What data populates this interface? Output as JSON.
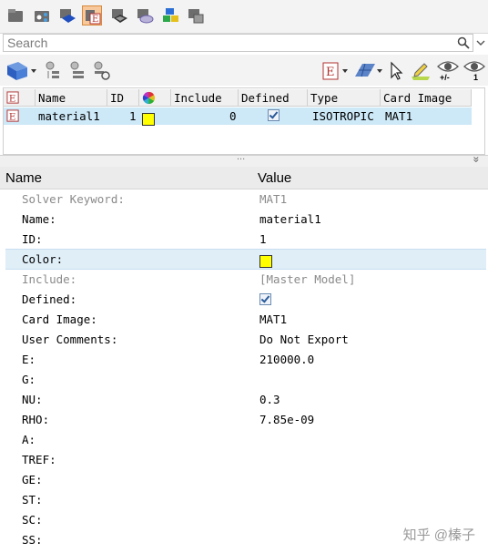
{
  "top_toolbar": {
    "icons": [
      "assembly-icon",
      "connector-icon",
      "component-icon",
      "material-icon",
      "property-icon",
      "system-icon",
      "multi-component-icon",
      "sets-icon"
    ],
    "active_index": 3
  },
  "search": {
    "placeholder": "Search"
  },
  "toolbar2": {
    "icons": [
      "entity-view-icon",
      "show-tree-icon",
      "show-list-icon",
      "refresh-list-icon",
      "card-edit-icon",
      "mesh-view-icon",
      "select-cursor-icon",
      "pencil-edit-icon",
      "show-hide-icon",
      "isolate-icon"
    ],
    "plusminus_label": "+/-",
    "isolate_label": "1"
  },
  "entity_table": {
    "columns": [
      "Name",
      "ID",
      "Include",
      "Defined",
      "Type",
      "Card Image"
    ],
    "rows": [
      {
        "name": "material1",
        "id": "1",
        "color": "#ffff00",
        "include": "0",
        "defined": true,
        "type": "ISOTROPIC",
        "card_image": "MAT1"
      }
    ]
  },
  "splitter": {
    "dots": "...",
    "collapse": "»"
  },
  "properties": {
    "header_name": "Name",
    "header_value": "Value",
    "rows": [
      {
        "name": "Solver Keyword:",
        "value": "MAT1"
      },
      {
        "name": "Name:",
        "value": "material1"
      },
      {
        "name": "ID:",
        "value": "1"
      },
      {
        "name": "Color:",
        "value": ""
      },
      {
        "name": "Include:",
        "value": "[Master Model]"
      },
      {
        "name": "Defined:",
        "value": ""
      },
      {
        "name": "Card Image:",
        "value": "MAT1"
      },
      {
        "name": "User Comments:",
        "value": "Do Not Export"
      },
      {
        "name": "E:",
        "value": "210000.0"
      },
      {
        "name": "G:",
        "value": ""
      },
      {
        "name": "NU:",
        "value": "0.3"
      },
      {
        "name": "RHO:",
        "value": "7.85e-09"
      },
      {
        "name": "A:",
        "value": ""
      },
      {
        "name": "TREF:",
        "value": ""
      },
      {
        "name": "GE:",
        "value": ""
      },
      {
        "name": "ST:",
        "value": ""
      },
      {
        "name": "SC:",
        "value": ""
      },
      {
        "name": "SS:",
        "value": ""
      }
    ]
  },
  "watermark": "知乎 @榛子",
  "colors": {
    "selection": "#cde8f7",
    "swatch": "#ffff00",
    "active_icon": "#f7c89b"
  }
}
